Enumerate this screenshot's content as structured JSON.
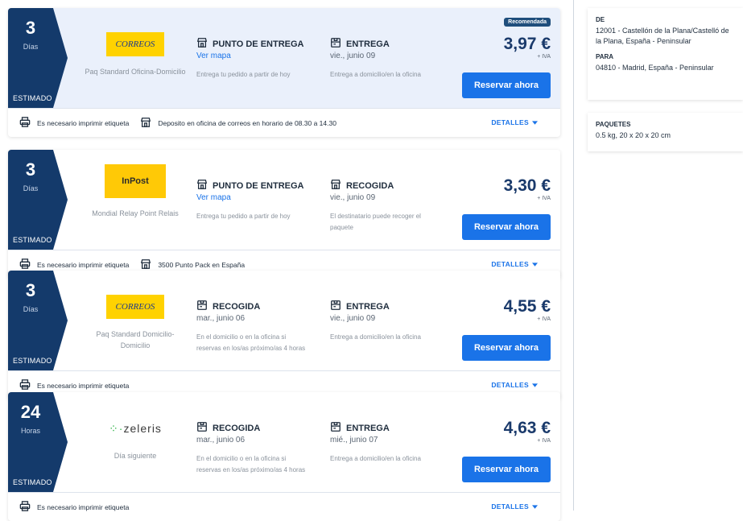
{
  "colors": {
    "navy": "#143a6b",
    "primary": "#1a73e8",
    "featured_bg": "#eaf0fb",
    "correos_yellow": "#ffd200",
    "inpost_yellow": "#ffc906",
    "zeleris_green": "#33b34a"
  },
  "offers": [
    {
      "recommended_label": "Recomendada",
      "eta_value": "3",
      "eta_unit": "Días",
      "eta_label": "ESTIMADO",
      "logo_icon": "correos-logo",
      "logo_text": "CORREOS",
      "service": "Paq Standard Oficina-Domicilio",
      "left_title": "PUNTO DE ENTREGA",
      "left_icon": "store-icon",
      "left_sub": "Ver mapa",
      "left_desc": "Entrega tu pedido a partir de hoy",
      "right_title": "ENTREGA",
      "right_icon": "box-icon",
      "right_sub": "vie., junio 09",
      "right_desc": "Entrega a domicilio/en la oficina",
      "price": "3,97 €",
      "iva": "+ IVA",
      "button": "Reservar ahora",
      "footer": [
        {
          "icon": "printer-icon",
          "text": "Es necesario imprimir etiqueta"
        },
        {
          "icon": "store-icon",
          "text": "Deposito en oficina de correos en horario de 08.30 a 14.30"
        }
      ],
      "details": "DETALLES"
    },
    {
      "eta_value": "3",
      "eta_unit": "Días",
      "eta_label": "ESTIMADO",
      "logo_icon": "inpost-logo",
      "logo_text": "InPost",
      "service": "Mondial Relay Point Relais",
      "left_title": "PUNTO DE ENTREGA",
      "left_icon": "store-icon",
      "left_sub": "Ver mapa",
      "left_desc": "Entrega tu pedido a partir de hoy",
      "right_title": "RECOGIDA",
      "right_icon": "store-icon",
      "right_sub": "vie., junio 09",
      "right_desc": "El destinatario puede recoger el paquete",
      "price": "3,30 €",
      "iva": "+ IVA",
      "button": "Reservar ahora",
      "footer": [
        {
          "icon": "printer-icon",
          "text": "Es necesario imprimir etiqueta"
        },
        {
          "icon": "store-icon",
          "text": "3500 Punto Pack en España"
        }
      ],
      "details": "DETALLES"
    },
    {
      "eta_value": "3",
      "eta_unit": "Días",
      "eta_label": "ESTIMADO",
      "logo_icon": "correos-logo",
      "logo_text": "CORREOS",
      "service": "Paq Standard Domicilio-Domicilio",
      "left_title": "RECOGIDA",
      "left_icon": "box-icon",
      "left_sub": "mar., junio 06",
      "left_desc": "En el domicilio o en la oficina si reservas en los/as próximo/as 4 horas",
      "right_title": "ENTREGA",
      "right_icon": "box-icon",
      "right_sub": "vie., junio 09",
      "right_desc": "Entrega a domicilio/en la oficina",
      "price": "4,55 €",
      "iva": "+ IVA",
      "button": "Reservar ahora",
      "footer": [
        {
          "icon": "printer-icon",
          "text": "Es necesario imprimir etiqueta"
        }
      ],
      "details": "DETALLES"
    },
    {
      "eta_value": "24",
      "eta_unit": "Horas",
      "eta_label": "ESTIMADO",
      "logo_icon": "zeleris-logo",
      "logo_text": "zeleris",
      "service": "Día siguiente",
      "left_title": "RECOGIDA",
      "left_icon": "box-icon",
      "left_sub": "mar., junio 06",
      "left_desc": "En el domicilio o en la oficina si reservas en los/as próximo/as 4 horas",
      "right_title": "ENTREGA",
      "right_icon": "box-icon",
      "right_sub": "mié., junio 07",
      "right_desc": "Entrega a domicilio/en la oficina",
      "price": "4,63 €",
      "iva": "+ IVA",
      "button": "Reservar ahora",
      "footer": [
        {
          "icon": "printer-icon",
          "text": "Es necesario imprimir etiqueta"
        }
      ],
      "details": "DETALLES"
    }
  ],
  "summary": {
    "from_label": "DE",
    "from_value": "12001 - Castellón de la Plana/Castelló de la Plana, España - Peninsular",
    "to_label": "PARA",
    "to_value": "04810 - Madrid, España - Peninsular",
    "packages_label": "PAQUETES",
    "packages_value": "0.5 kg, 20 x 20 x 20 cm"
  }
}
